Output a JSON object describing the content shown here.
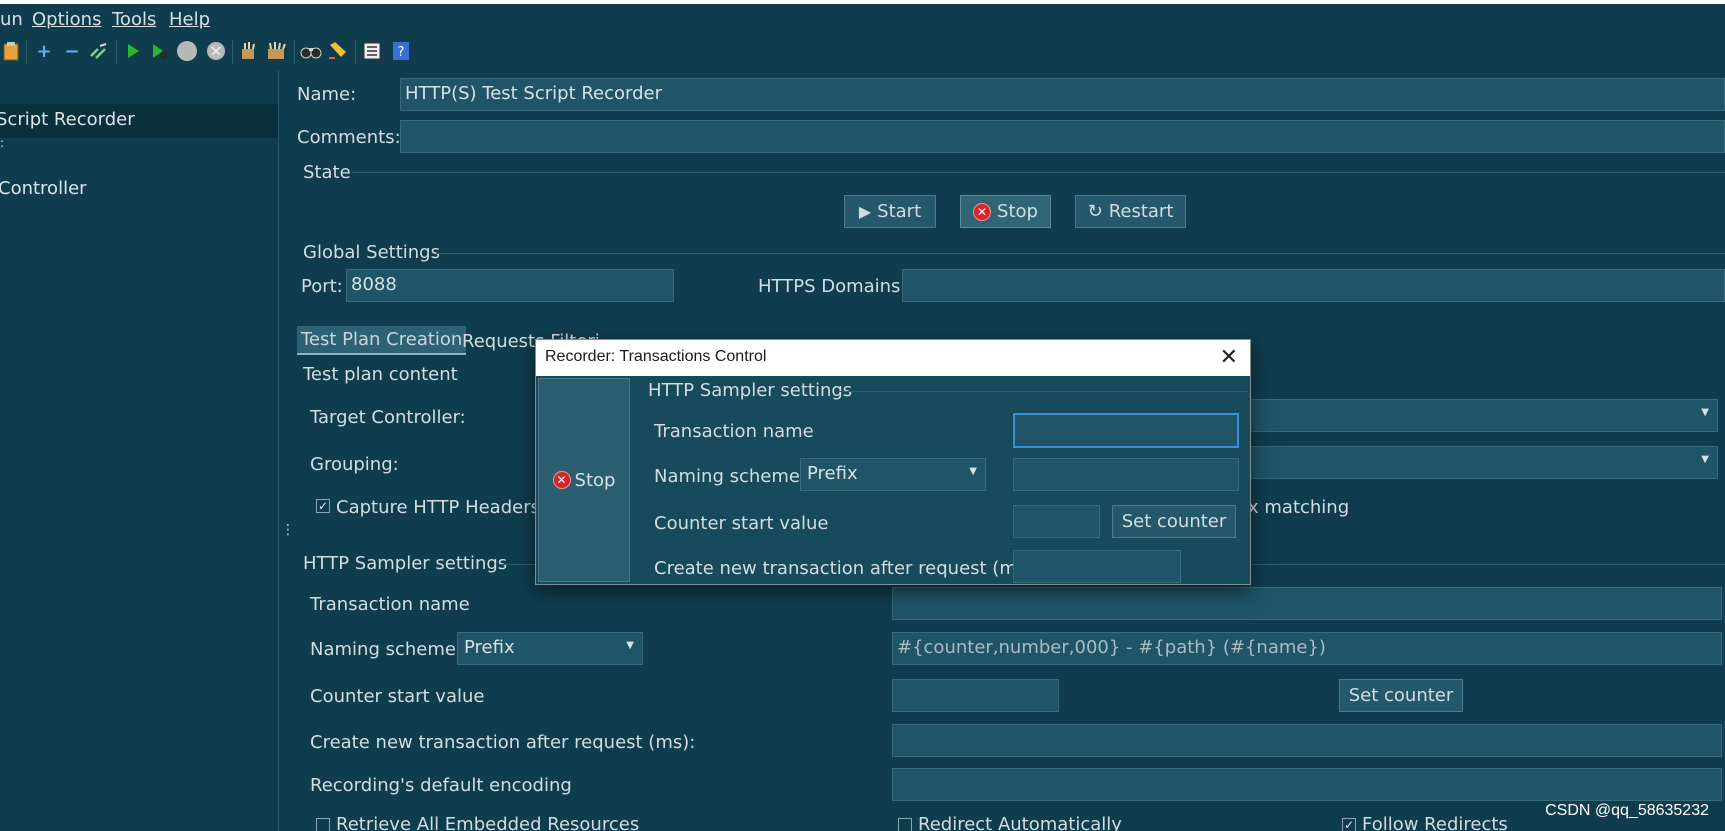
{
  "menu": [
    "un",
    "Options",
    "Tools",
    "Help"
  ],
  "toolbar_icons": [
    "clipboard-icon",
    "add-icon",
    "remove-icon",
    "toggle-icon",
    "start-icon",
    "start-no-pause-icon",
    "stop-icon",
    "shutdown-icon",
    "clear-icon",
    "clear-all-icon",
    "search-icon",
    "reset-search-icon",
    "function-helper-icon",
    "help-icon"
  ],
  "tree": {
    "items": [
      "Script Recorder",
      ":",
      "Controller"
    ],
    "selected": "Script Recorder"
  },
  "recorder": {
    "name_label": "Name:",
    "name_value": "HTTP(S) Test Script Recorder",
    "comments_label": "Comments:",
    "comments_value": "",
    "state_label": "State",
    "start_label": "Start",
    "stop_label": "Stop",
    "restart_label": "Restart",
    "global_label": "Global Settings",
    "port_label": "Port:",
    "port_value": "8088",
    "https_label": "HTTPS Domains:",
    "https_value": "",
    "tabs": [
      "Test Plan Creation",
      "Requests Filtering"
    ],
    "tab_visible": [
      "Test Plan Creation",
      "Requests Filteri"
    ],
    "test_plan_content_label": "Test plan content",
    "target_controller_label": "Target Controller:",
    "grouping_label": "Grouping:",
    "capture_headers_label": "Capture HTTP Headers",
    "capture_headers_checked": true,
    "regex_partial": "x matching",
    "sampler_settings_label": "HTTP Sampler settings",
    "transaction_name_label": "Transaction name",
    "naming_scheme_label": "Naming scheme",
    "naming_scheme_value": "Prefix",
    "naming_format_placeholder": "#{counter,number,000} - #{path} (#{name})",
    "counter_start_label": "Counter start value",
    "set_counter_label": "Set counter",
    "new_transaction_label": "Create new transaction after request (ms):",
    "encoding_label": "Recording's default encoding",
    "retrieve_label": "Retrieve All Embedded Resources",
    "redirect_label": "Redirect Automatically",
    "follow_label": "Follow Redirects",
    "follow_checked": true
  },
  "dialog": {
    "title": "Recorder: Transactions Control",
    "stop_label": "Stop",
    "section_label": "HTTP Sampler settings",
    "transaction_name_label": "Transaction name",
    "naming_scheme_label": "Naming scheme",
    "naming_scheme_value": "Prefix",
    "counter_start_label": "Counter start value",
    "set_counter_label": "Set counter",
    "new_transaction_label": "Create new transaction after request (ms):"
  },
  "watermark": "CSDN @qq_58635232",
  "colors": {
    "background": "#103d4e",
    "field": "#1f5566",
    "selection": "#0a2f3d",
    "stop_icon": "#d7262b",
    "dialog_title_bg": "#ffffff"
  }
}
